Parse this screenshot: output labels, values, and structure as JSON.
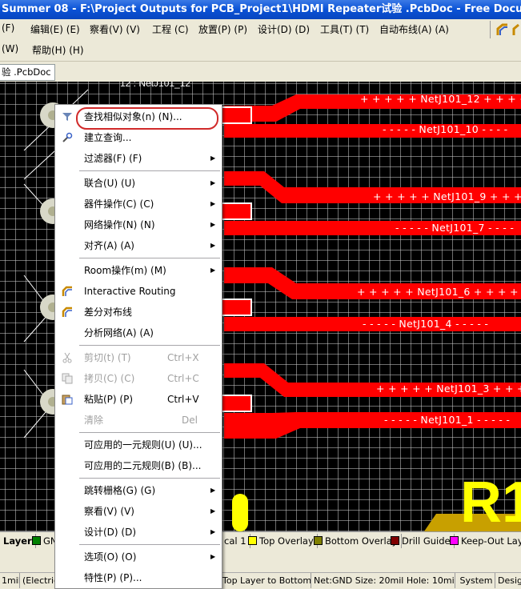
{
  "window": {
    "title": "Summer 08 - F:\\Project Outputs for PCB_Project1\\HDMI Repeater试验 .PcbDoc - Free Documents."
  },
  "menubar": {
    "row1": [
      "(F)",
      "编辑(E) (E)",
      "察看(V) (V)",
      "工程 (C)",
      "放置(P) (P)",
      "设计(D) (D)",
      "工具(T) (T)",
      "自动布线(A) (A)"
    ],
    "row2": [
      "(W)",
      "帮助(H) (H)"
    ]
  },
  "document_tab": {
    "label": "验 .PcbDoc"
  },
  "pcb": {
    "nets": [
      {
        "label": "+ + + + +  NetJ101_12  + + + +"
      },
      {
        "label": "- - - - -  NetJ101_10  - - - -"
      },
      {
        "label": "+ + + + +  NetJ101_9  + + +"
      },
      {
        "label": "- - - - -  NetJ101_7  - - - -"
      },
      {
        "label": "+ + + + +  NetJ101_6  + + + + +"
      },
      {
        "label": "- - - - -  NetJ101_4  - - - - -"
      },
      {
        "label": "+ + + + +  NetJ101_3  + + + +"
      },
      {
        "label": "- - - - -  NetJ101_1  - - - - -"
      }
    ],
    "top_label": "12 : NetJ101_12",
    "designator": "R1",
    "colors": {
      "track": "#ff0000",
      "pad": "#ffffff",
      "overlay": "#ffff00",
      "mech": "#c8a000"
    }
  },
  "context_menu": {
    "items": [
      {
        "label": "查找相似对象(n) (N)...",
        "icon": "filter-funnel-icon"
      },
      {
        "label": "建立查询...",
        "icon": "wrench-query-icon"
      },
      {
        "label": "过滤器(F) (F)",
        "submenu": true
      },
      {
        "label": "联合(U) (U)",
        "submenu": true
      },
      {
        "label": "器件操作(C) (C)",
        "submenu": true
      },
      {
        "label": "网络操作(N) (N)",
        "submenu": true
      },
      {
        "label": "对齐(A) (A)",
        "submenu": true
      },
      {
        "label": "Room操作(m) (M)",
        "submenu": true
      },
      {
        "label": "Interactive Routing",
        "icon": "interactive-routing-icon"
      },
      {
        "label": "差分对布线",
        "icon": "diff-pair-routing-icon"
      },
      {
        "label": "分析网络(A) (A)"
      },
      {
        "label": "剪切(t) (T)",
        "shortcut": "Ctrl+X",
        "disabled": true,
        "icon": "cut-icon"
      },
      {
        "label": "拷贝(C) (C)",
        "shortcut": "Ctrl+C",
        "disabled": true,
        "icon": "copy-icon"
      },
      {
        "label": "粘贴(P) (P)",
        "shortcut": "Ctrl+V",
        "icon": "paste-icon"
      },
      {
        "label": "清除",
        "shortcut": "Del",
        "disabled": true
      },
      {
        "label": "可应用的一元规则(U) (U)..."
      },
      {
        "label": "可应用的二元规则(B) (B)..."
      },
      {
        "label": "跳转栅格(G) (G)",
        "submenu": true
      },
      {
        "label": "察看(V) (V)",
        "submenu": true
      },
      {
        "label": "设计(D) (D)",
        "submenu": true
      },
      {
        "label": "选项(O) (O)",
        "submenu": true
      },
      {
        "label": "特性(P) (P)..."
      }
    ]
  },
  "layer_tabs": [
    {
      "label": "Layer",
      "color": null
    },
    {
      "label": "GN",
      "color": "#008000"
    },
    {
      "label": "cal 1",
      "color": null
    },
    {
      "label": "Top Overlay",
      "color": "#ffff00"
    },
    {
      "label": "Bottom Overlay",
      "color": "#808000"
    },
    {
      "label": "Drill Guide",
      "color": "#800000"
    },
    {
      "label": "Keep-Out Layer",
      "color": "#ff00ff"
    }
  ],
  "status": {
    "grid": "1mil",
    "electrical": "(Electric",
    "layers": "Top Layer to Bottom La",
    "net_info": "Net:GND Size: 20mil Hole: 10mil",
    "system_btn": "System",
    "design_btn": "Desig"
  }
}
